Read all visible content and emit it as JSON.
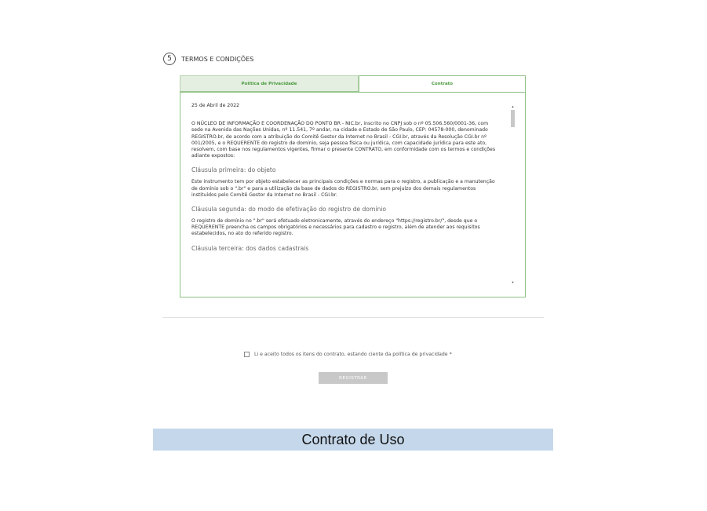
{
  "step": {
    "number": "5",
    "title": "TERMOS E CONDIÇÕES"
  },
  "tabs": [
    {
      "label": "Política de Privacidade",
      "active": false
    },
    {
      "label": "Contrato",
      "active": true
    }
  ],
  "contract": {
    "date": "25 de Abril de 2022",
    "intro": "O NÚCLEO DE INFORMAÇÃO E COORDENAÇÃO DO PONTO BR - NIC.br, inscrito no CNPJ sob o nº 05.506.560/0001-36, com sede na Avenida das Nações Unidas, nº 11.541, 7º andar, na cidade e Estado de São Paulo, CEP: 04578-000, denominado REGISTRO.br, de acordo com a atribuição do Comitê Gestor da Internet no Brasil - CGI.br, através da Resolução CGI.br nº 001/2005, e o REQUERENTE do registro de domínio, seja pessoa física ou jurídica, com capacidade jurídica para este ato, resolvem, com base nos regulamentos vigentes, firmar o presente CONTRATO, em conformidade com os termos e condições adiante expostos:",
    "clause1_title": "Cláusula primeira: do objeto",
    "clause1_text": "Este instrumento tem por objeto estabelecer as principais condições e normas para o registro, a publicação e a manutenção de domínio sob o \".br\" e para a utilização da base de dados do REGISTRO.br, sem prejuízo dos demais regulamentos instituídos pelo Comitê Gestor da Internet no Brasil - CGI.br.",
    "clause2_title": "Cláusula segunda: do modo de efetivação do registro de domínio",
    "clause2_text": "O registro de domínio no \".br\" será efetuado eletronicamente, através do endereço \"https://registro.br/\", desde que o REQUERENTE preencha os campos obrigatórios e necessários para cadastro e registro, além de atender aos requisitos estabelecidos, no ato do referido registro.",
    "clause3_title": "Cláusula terceira: dos dados cadastrais"
  },
  "agree_label": "Li e aceito todos os itens do contrato, estando ciente da política de privacidade *",
  "register_label": "REGISTRAR",
  "caption": "Contrato de Uso",
  "colors": {
    "accent_green": "#4a9a3e",
    "caption_bg": "#c5d7ea"
  }
}
